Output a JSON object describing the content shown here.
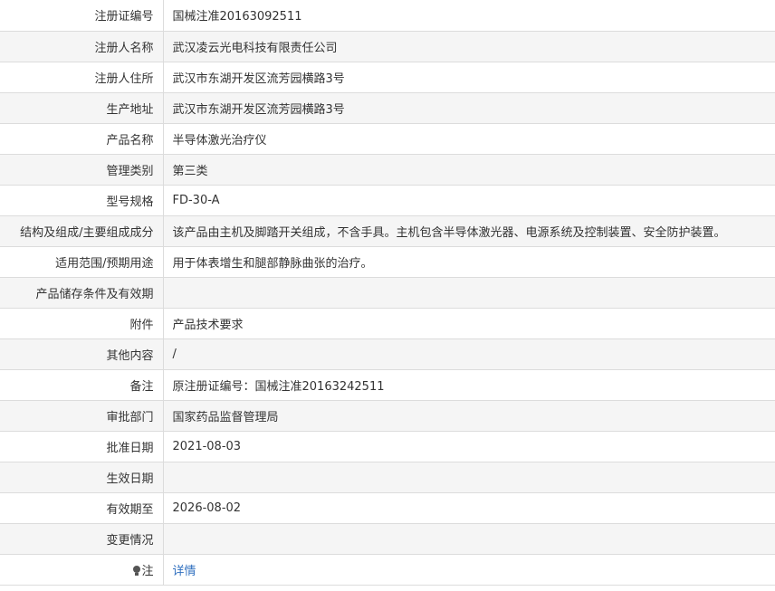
{
  "rows": [
    {
      "label": "注册证编号",
      "value": "国械注准20163092511"
    },
    {
      "label": "注册人名称",
      "value": "武汉凌云光电科技有限责任公司"
    },
    {
      "label": "注册人住所",
      "value": "武汉市东湖开发区流芳园横路3号"
    },
    {
      "label": "生产地址",
      "value": "武汉市东湖开发区流芳园横路3号"
    },
    {
      "label": "产品名称",
      "value": "半导体激光治疗仪"
    },
    {
      "label": "管理类别",
      "value": "第三类"
    },
    {
      "label": "型号规格",
      "value": "FD-30-A"
    },
    {
      "label": "结构及组成/主要组成成分",
      "value": "该产品由主机及脚踏开关组成，不含手具。主机包含半导体激光器、电源系统及控制装置、安全防护装置。"
    },
    {
      "label": "适用范围/预期用途",
      "value": "用于体表增生和腿部静脉曲张的治疗。"
    },
    {
      "label": "产品储存条件及有效期",
      "value": ""
    },
    {
      "label": "附件",
      "value": "产品技术要求"
    },
    {
      "label": "其他内容",
      "value": "/"
    },
    {
      "label": "备注",
      "value": "原注册证编号：国械注准20163242511"
    },
    {
      "label": "审批部门",
      "value": "国家药品监督管理局"
    },
    {
      "label": "批准日期",
      "value": "2021-08-03"
    },
    {
      "label": "生效日期",
      "value": ""
    },
    {
      "label": "有效期至",
      "value": "2026-08-02"
    },
    {
      "label": "变更情况",
      "value": ""
    }
  ],
  "note": {
    "icon": "lightbulb-icon",
    "label": "注",
    "link_text": "详情"
  },
  "colors": {
    "link": "#2f6fbf",
    "border": "#dcdcdc",
    "stripe": "#f5f5f5",
    "text": "#333333"
  }
}
